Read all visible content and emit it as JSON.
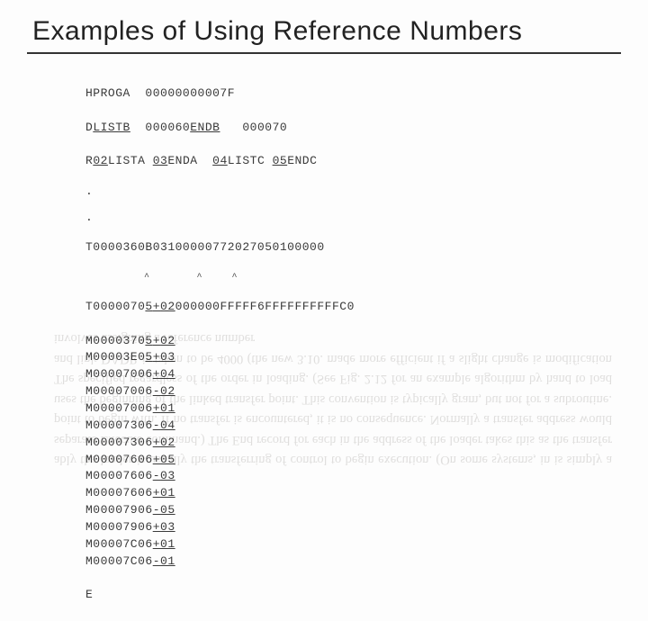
{
  "title": "Examples of Using Reference Numbers",
  "header": {
    "h": "HPROGA  00000000007F",
    "d1_pre": "D",
    "d1_a": "LISTB",
    "d1_mid": "  000060",
    "d1_b": "ENDB",
    "d1_end": "   000070",
    "d2_pre": "R",
    "d2_a": "02",
    "d2_a2": "LISTA ",
    "d2_b": "03",
    "d2_b2": "ENDA  ",
    "d2_c": "04",
    "d2_c2": "LISTC ",
    "d2_d": "05",
    "d2_d2": "ENDC"
  },
  "t1": "T0000360B03100000772027050100000",
  "t1c": "          ^        ^     ^",
  "t2_a": "T0000070",
  "t2_b": "5",
  "t2_c": "+",
  "t2_d": "02",
  "t2_e": "000000FFFFF6FFFFFFFFFFC0",
  "mrows": [
    {
      "a": "M0000370",
      "b": "5",
      "c": "+",
      "d": "02"
    },
    {
      "a": "M00003E0",
      "b": "5",
      "c": "+",
      "d": "03"
    },
    {
      "a": "M00007006",
      "b": "",
      "c": "+",
      "d": "04"
    },
    {
      "a": "M00007006",
      "b": "",
      "c": "-",
      "d": "02"
    },
    {
      "a": "M00007006",
      "b": "",
      "c": "+",
      "d": "01"
    },
    {
      "a": "M00007306",
      "b": "",
      "c": "-",
      "d": "04"
    },
    {
      "a": "M00007306",
      "b": "",
      "c": "+",
      "d": "02"
    },
    {
      "a": "M00007606",
      "b": "",
      "c": "+",
      "d": "05"
    },
    {
      "a": "M00007606",
      "b": "",
      "c": "-",
      "d": "03"
    },
    {
      "a": "M00007606",
      "b": "",
      "c": "+",
      "d": "01"
    },
    {
      "a": "M00007906",
      "b": "",
      "c": "-",
      "d": "05"
    },
    {
      "a": "M00007906",
      "b": "",
      "c": "+",
      "d": "03"
    },
    {
      "a": "M00007C06",
      "b": "",
      "c": "+",
      "d": "01"
    },
    {
      "a": "M00007C06",
      "b": "",
      "c": "-",
      "d": "01"
    }
  ],
  "end": "E",
  "ghost": "ably the loader is usually the transferring of control to begin execution. (On some systems, in is simply a separate Execute command.) The End record for each in the address of the loader takes this as the transfer point to begin with. If no transfer is encountered, it is no consequence. Normally a transfer address would uses the beginning of the linked transfer point. This convention is typically gram, but not for a subroutine. The specified regardless of the order in loading. (See Fig. 2.12 for an example algorithm by hand to load and link DADR is taken to be 4000 (the new 3.10. made more efficient if a slight change is modification involves assigning a reference number"
}
